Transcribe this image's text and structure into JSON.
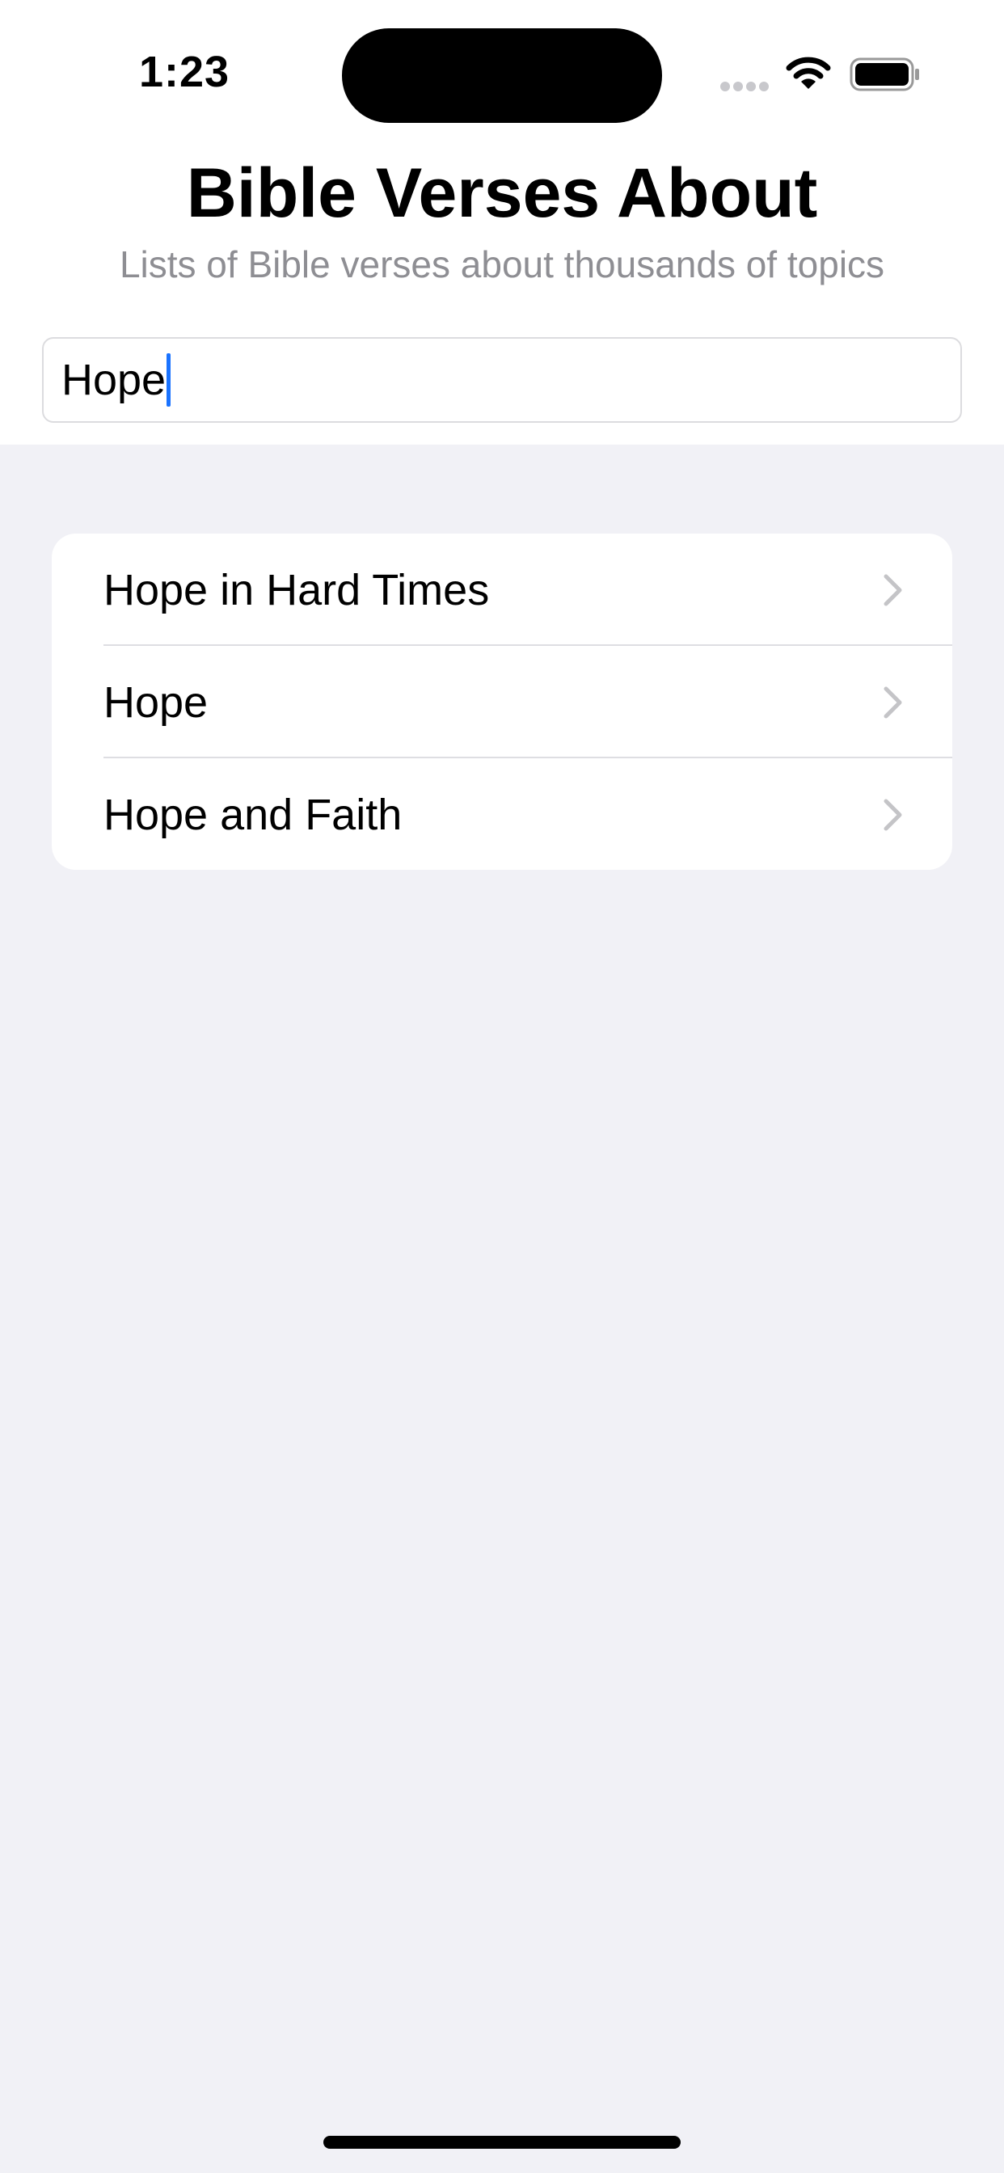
{
  "status_bar": {
    "time": "1:23",
    "icons": [
      "signal-dots-icon",
      "wifi-icon",
      "battery-icon"
    ]
  },
  "header": {
    "title": "Bible Verses About",
    "subtitle": "Lists of Bible verses about thousands of topics"
  },
  "search": {
    "value": "Hope",
    "placeholder": ""
  },
  "results": [
    {
      "label": "Hope in Hard Times",
      "icon": "chevron-right-icon"
    },
    {
      "label": "Hope",
      "icon": "chevron-right-icon"
    },
    {
      "label": "Hope and Faith",
      "icon": "chevron-right-icon"
    }
  ],
  "colors": {
    "background": "#f1f1f6",
    "header_background": "#ffffff",
    "subtitle": "#8e8e93",
    "caret": "#1a73ff",
    "chevron": "#c4c4c7"
  }
}
